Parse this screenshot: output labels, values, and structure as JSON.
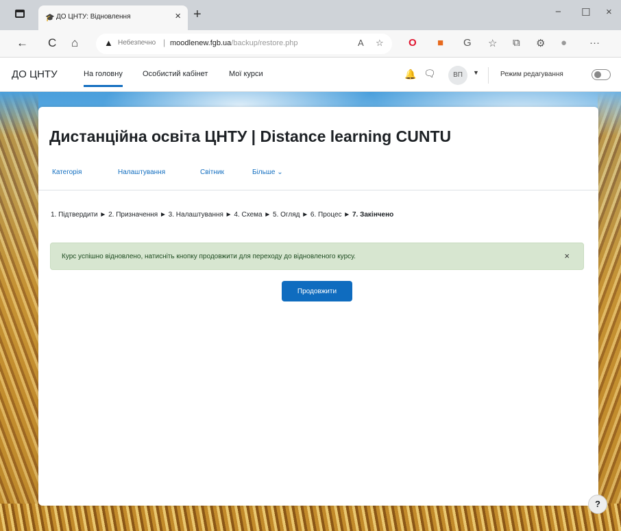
{
  "browser": {
    "tab_title": "ДО ЦНТУ: Відновлення",
    "tab_favicon": "🎓",
    "tab_close": "×",
    "new_tab": "+",
    "win_minimize": "−",
    "win_maximize": "☐",
    "win_close": "×",
    "back": "←",
    "reload": "C",
    "home": "⌂",
    "url_warning": "▲",
    "url_insecure": "Небезпечно",
    "url_sep": "|",
    "url_host": "moodlenew.fgb.ua",
    "url_path": "/backup/restore.php",
    "read_aloud": "A",
    "fav_add": "☆",
    "opera_icon": "O",
    "ext_icon": "■",
    "g_icon": "G",
    "favorites": "☆",
    "collections": "⧉",
    "extensions": "⚙",
    "profile": "●",
    "more": "···"
  },
  "navbar": {
    "brand": "ДО ЦНТУ",
    "links": [
      "На головну",
      "Особистий кабінет",
      "Мої курси"
    ],
    "bell": "🔔",
    "chat": "🗨",
    "avatar": "ВП",
    "avatar_caret": "▼",
    "edit_mode_label": "Режим редагування"
  },
  "main": {
    "heading": "Дистанційна освіта ЦНТУ | Distance learning CUNTU",
    "tabs": [
      "Категорія",
      "Налаштування",
      "Світник",
      "Більше ⌄"
    ],
    "breadcrumb_steps": "1. Підтвердити ► 2. Призначення ► 3. Налаштування ► 4. Схема ► 5. Огляд ► 6. Процес ►",
    "breadcrumb_current": "7. Закінчено",
    "alert_message": "Курс успішно відновлено, натисніть кнопку продовжити для переходу до відновленого курсу.",
    "alert_close": "×",
    "continue_button": "Продовжити"
  },
  "help_button": "?",
  "colors": {
    "accent": "#0f6cbf",
    "alert_bg": "#d7e6d0"
  }
}
